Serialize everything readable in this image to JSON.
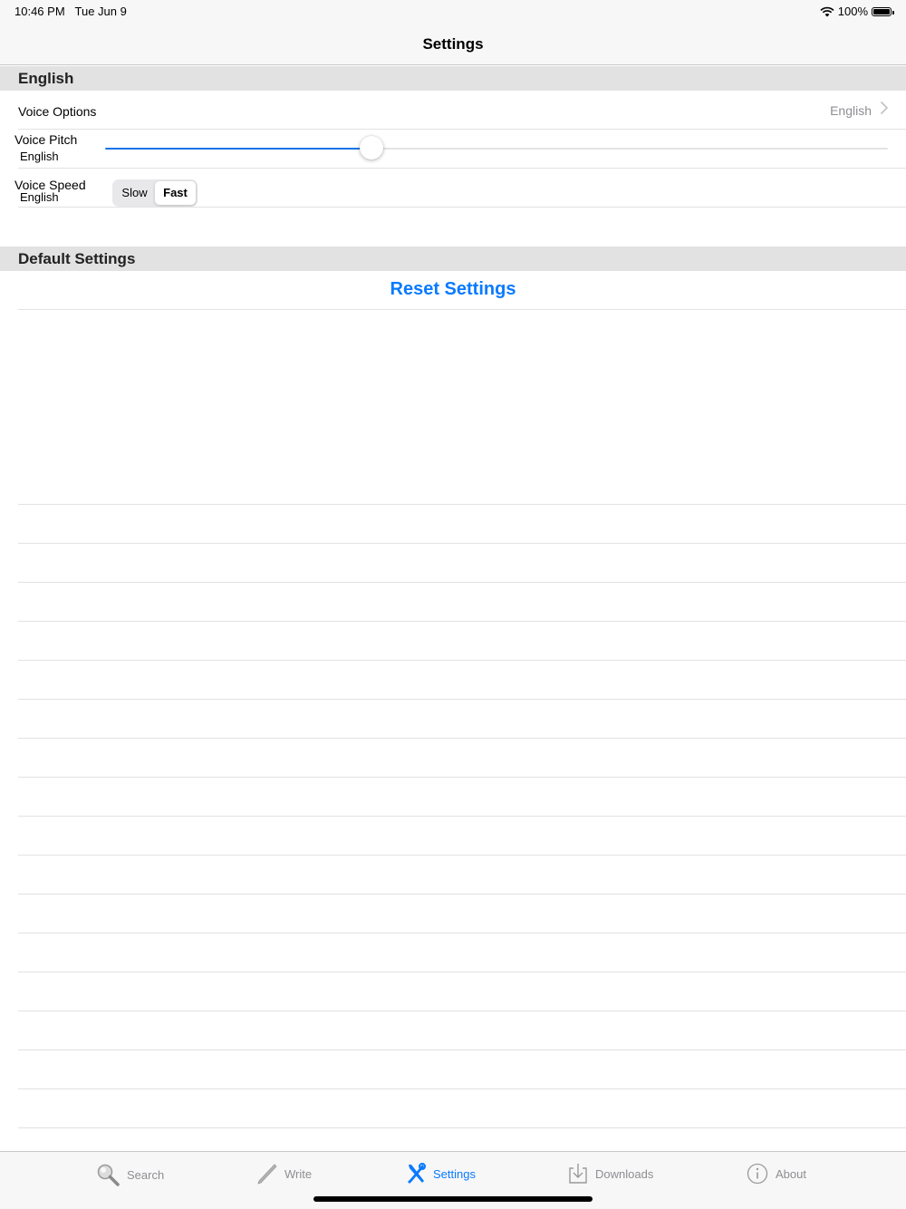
{
  "status_bar": {
    "time": "10:46 PM",
    "date": "Tue Jun 9",
    "battery": "100%",
    "battery_level": 1.0
  },
  "nav": {
    "title": "Settings"
  },
  "sections": {
    "language": {
      "header": "English",
      "voice_options": {
        "label": "Voice Options",
        "value": "English"
      },
      "voice_pitch": {
        "label": "Voice Pitch",
        "sublabel": "English",
        "value_fraction": 0.34
      },
      "voice_speed": {
        "label": "Voice Speed",
        "sublabel": "English",
        "options": [
          "Slow",
          "Fast"
        ],
        "selected": "Fast"
      }
    },
    "defaults": {
      "header": "Default Settings",
      "reset_label": "Reset Settings"
    }
  },
  "tabs": [
    {
      "label": "Search",
      "icon": "magnifier-icon"
    },
    {
      "label": "Write",
      "icon": "pencil-icon"
    },
    {
      "label": "Settings",
      "icon": "tools-icon",
      "active": true
    },
    {
      "label": "Downloads",
      "icon": "download-tray-icon"
    },
    {
      "label": "About",
      "icon": "info-icon"
    }
  ],
  "colors": {
    "accent": "#0a7aff",
    "slider": "#1a73e8",
    "header_bg": "#e2e2e2"
  }
}
